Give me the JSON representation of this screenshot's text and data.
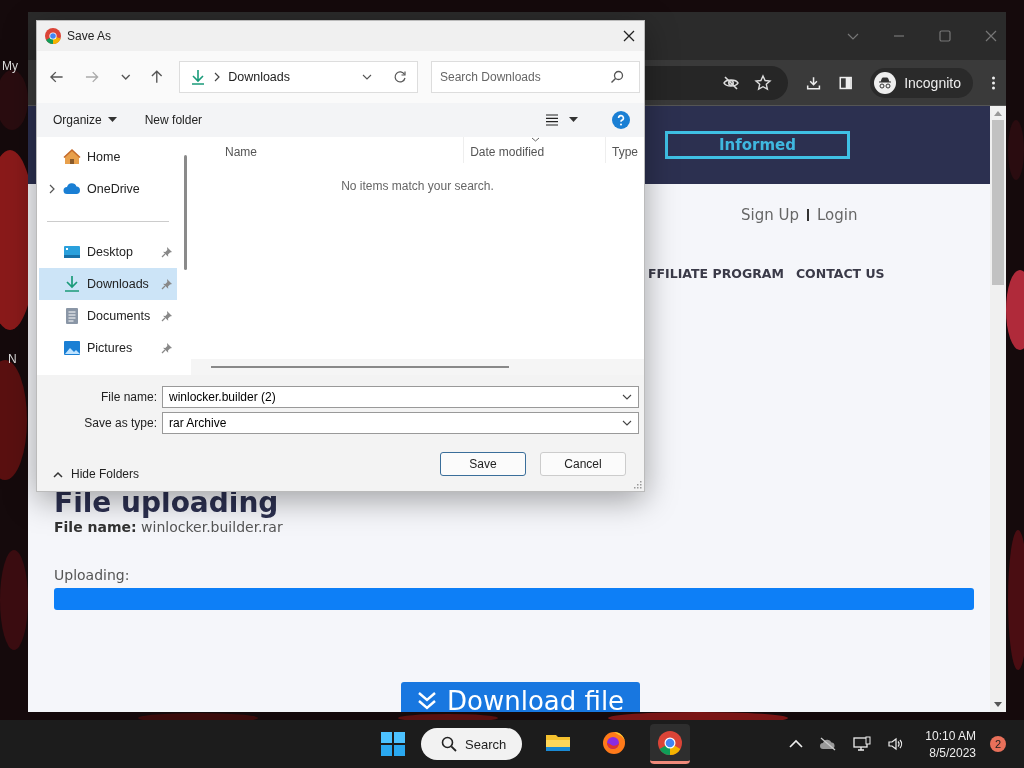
{
  "desktop": {
    "icon_labels": [
      "My",
      "N"
    ]
  },
  "browser": {
    "toolbar": {
      "profile": "Incognito"
    },
    "page": {
      "header_button": "Informed",
      "auth_links": [
        "Sign Up",
        "Login"
      ],
      "nav": [
        "FFILIATE PROGRAM",
        "CONTACT US"
      ],
      "heading": "File uploading",
      "file_line": "**File name:** winlocker.builder.rar",
      "progress": {
        "label": "Uploading:",
        "level": 1
      },
      "download_button": "Download file"
    }
  },
  "dialog": {
    "title": "Save As",
    "nav_buttons": [
      {
        "kind": "back",
        "disabled": false
      },
      {
        "kind": "forward",
        "disabled": true
      },
      {
        "kind": "recent",
        "disabled": false
      },
      {
        "kind": "up",
        "disabled": false
      }
    ],
    "location": "Downloads",
    "search": {
      "placeholder": "Search Downloads"
    },
    "commands": [
      {
        "label": "Organize",
        "menu": true
      },
      {
        "label": "New folder",
        "menu": false
      }
    ],
    "nav_pane": [
      {
        "kind": "home",
        "label": "Home",
        "selected": false,
        "pinned": false,
        "expandable": false
      },
      {
        "kind": "cloud",
        "label": "OneDrive",
        "selected": false,
        "pinned": false,
        "expandable": true
      },
      {
        "kind": "divider"
      },
      {
        "kind": "desktop",
        "label": "Desktop",
        "selected": false,
        "pinned": true,
        "expandable": false
      },
      {
        "kind": "downloads",
        "label": "Downloads",
        "selected": true,
        "pinned": true,
        "expandable": false
      },
      {
        "kind": "documents",
        "label": "Documents",
        "selected": false,
        "pinned": true,
        "expandable": false
      },
      {
        "kind": "pictures",
        "label": "Pictures",
        "selected": false,
        "pinned": true,
        "expandable": false
      }
    ],
    "columns": [
      {
        "label": "Name",
        "sorted": false
      },
      {
        "label": "Date modified",
        "sorted": true
      },
      {
        "label": "Type",
        "sorted": false
      }
    ],
    "empty_message": "No items match your search.",
    "fields": [
      {
        "label": "File name:",
        "value": "winlocker.builder (2)"
      },
      {
        "label": "Save as type:",
        "value": "rar Archive"
      }
    ],
    "hide_folders": "Hide Folders",
    "buttons": [
      {
        "label": "Save",
        "default": true
      },
      {
        "label": "Cancel",
        "default": false
      }
    ]
  },
  "taskbar": {
    "search": "Search",
    "apps": [
      {
        "kind": "explorer",
        "selected": false
      },
      {
        "kind": "firefox",
        "selected": false
      },
      {
        "kind": "chrome",
        "selected": true
      }
    ],
    "time": "10:10 AM",
    "date": "8/5/2023",
    "notifications": "2"
  }
}
